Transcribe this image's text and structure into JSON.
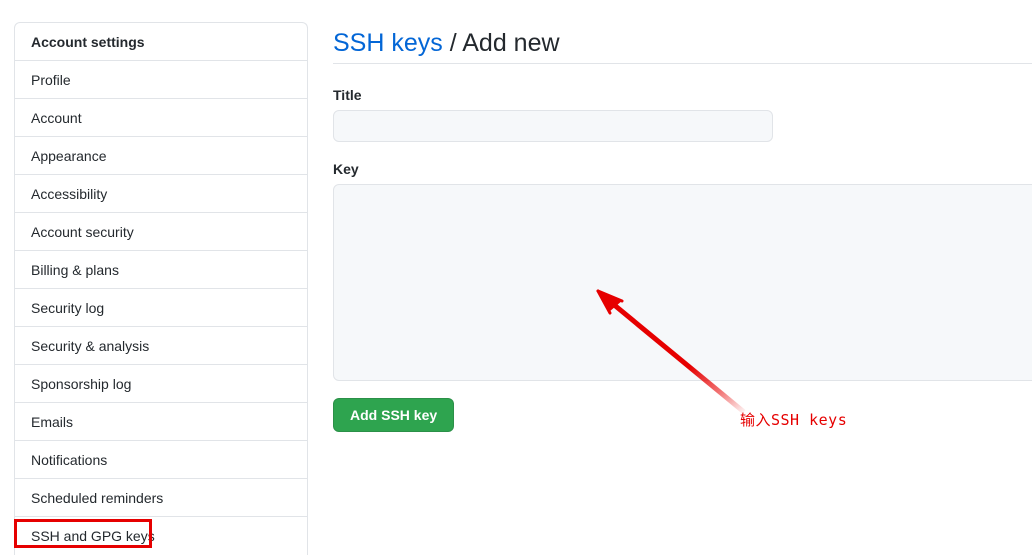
{
  "sidebar": {
    "items": [
      {
        "label": "Account settings",
        "heading": true,
        "highlighted": false
      },
      {
        "label": "Profile",
        "heading": false,
        "highlighted": false
      },
      {
        "label": "Account",
        "heading": false,
        "highlighted": false
      },
      {
        "label": "Appearance",
        "heading": false,
        "highlighted": false
      },
      {
        "label": "Accessibility",
        "heading": false,
        "highlighted": false
      },
      {
        "label": "Account security",
        "heading": false,
        "highlighted": false
      },
      {
        "label": "Billing & plans",
        "heading": false,
        "highlighted": false
      },
      {
        "label": "Security log",
        "heading": false,
        "highlighted": false
      },
      {
        "label": "Security & analysis",
        "heading": false,
        "highlighted": false
      },
      {
        "label": "Sponsorship log",
        "heading": false,
        "highlighted": false
      },
      {
        "label": "Emails",
        "heading": false,
        "highlighted": false
      },
      {
        "label": "Notifications",
        "heading": false,
        "highlighted": false
      },
      {
        "label": "Scheduled reminders",
        "heading": false,
        "highlighted": false
      },
      {
        "label": "SSH and GPG keys",
        "heading": false,
        "highlighted": true
      }
    ]
  },
  "main": {
    "breadcrumb": {
      "link_text": "SSH keys",
      "separator": "/",
      "current": "Add new"
    },
    "title_field": {
      "label": "Title",
      "value": "",
      "placeholder": ""
    },
    "key_field": {
      "label": "Key",
      "value": "",
      "placeholder": ""
    },
    "submit_label": "Add SSH key"
  },
  "annotations": {
    "note_text": "输入SSH keys",
    "color": "#e60000"
  },
  "colors": {
    "link": "#0366d6",
    "button_green": "#2ea44f",
    "border": "#e1e4e8",
    "field_bg": "#f6f8fa",
    "text": "#24292e",
    "annotation_red": "#e60000"
  }
}
